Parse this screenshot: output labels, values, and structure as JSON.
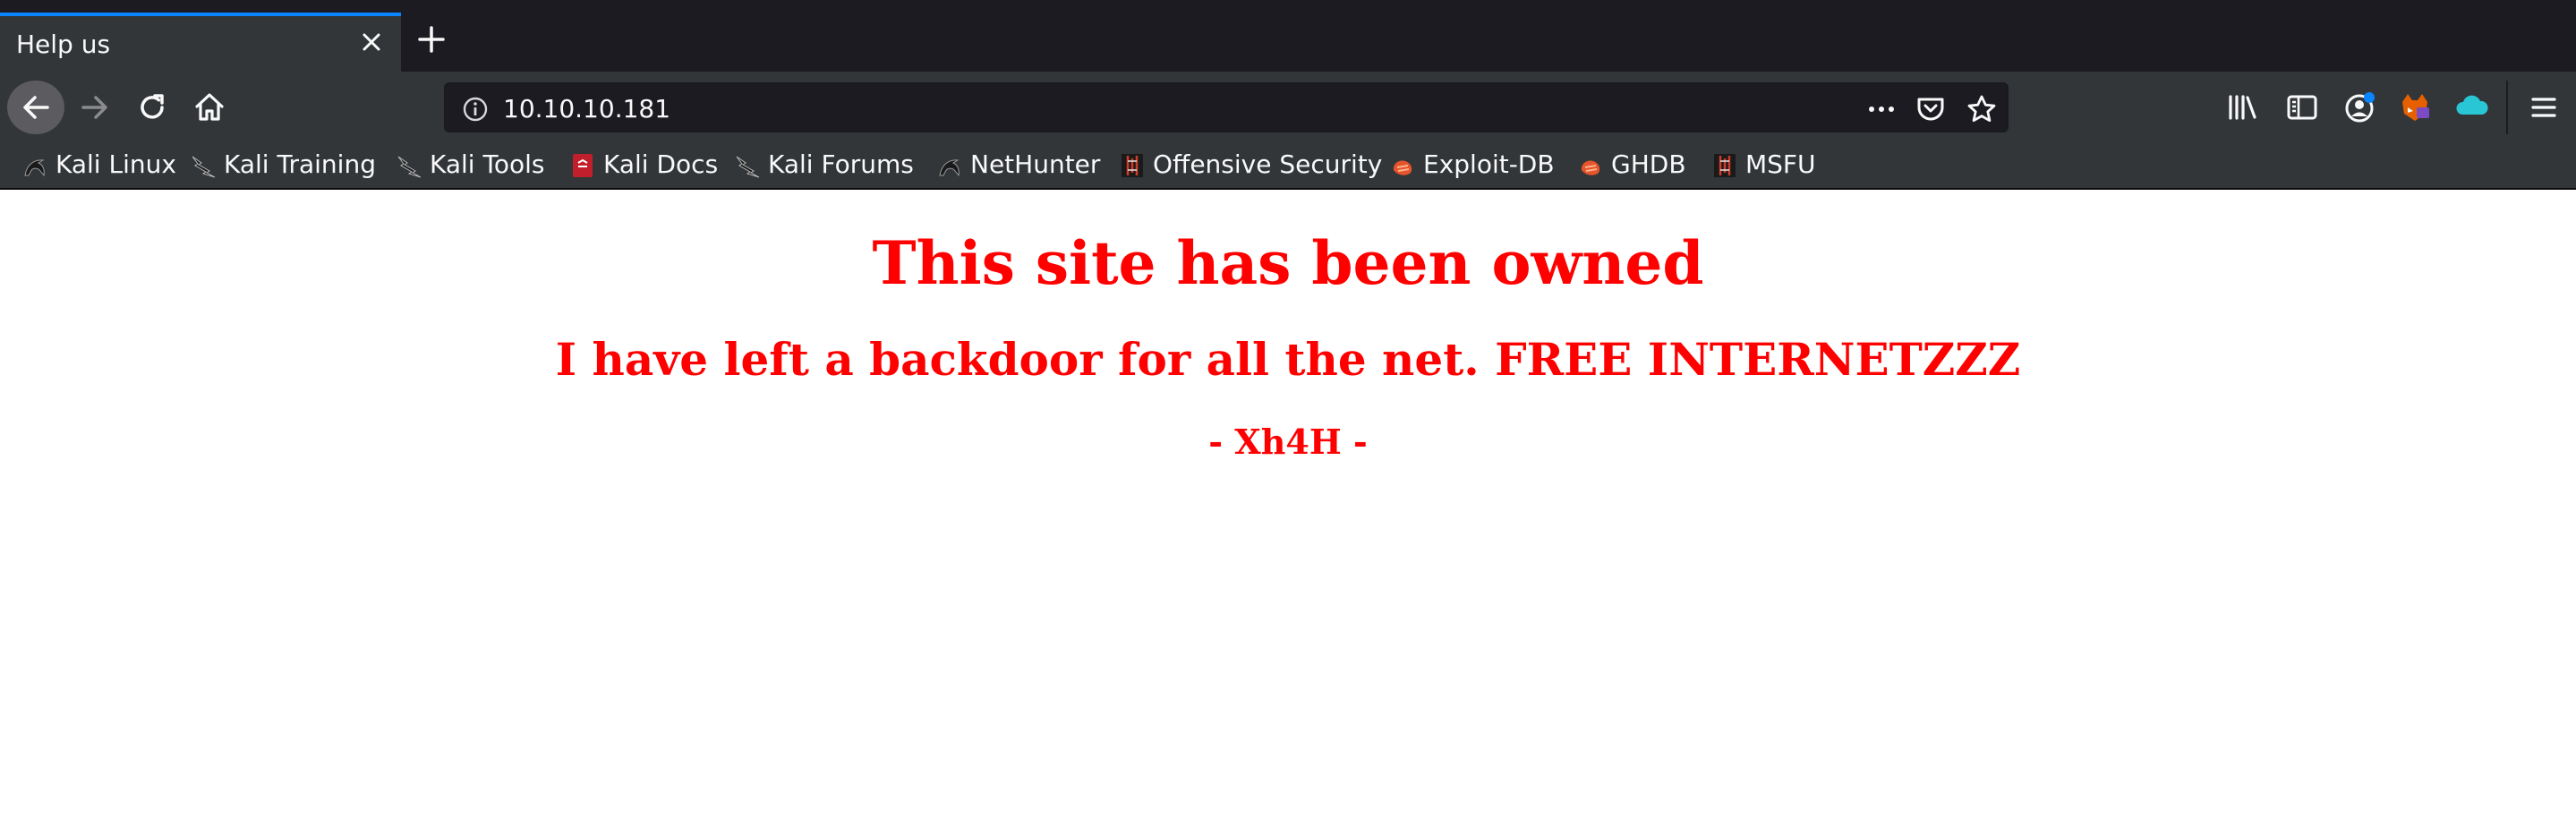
{
  "browser": {
    "tab": {
      "title": "Help us"
    },
    "url": "10.10.10.181",
    "bookmarks": [
      {
        "label": "Kali Linux",
        "icon": "kali-dragon-icon"
      },
      {
        "label": "Kali Training",
        "icon": "kali-dragon-icon"
      },
      {
        "label": "Kali Tools",
        "icon": "kali-dragon-icon"
      },
      {
        "label": "Kali Docs",
        "icon": "kali-docs-icon"
      },
      {
        "label": "Kali Forums",
        "icon": "kali-dragon-icon"
      },
      {
        "label": "NetHunter",
        "icon": "nethunter-icon"
      },
      {
        "label": "Offensive Security",
        "icon": "offsec-icon"
      },
      {
        "label": "Exploit-DB",
        "icon": "exploitdb-icon"
      },
      {
        "label": "GHDB",
        "icon": "exploitdb-icon"
      },
      {
        "label": "MSFU",
        "icon": "offsec-icon"
      }
    ],
    "colors": {
      "chrome_dark": "#1c1b22",
      "toolbar": "#323639",
      "accent": "#0a84ff",
      "page_text": "#ff0000"
    }
  },
  "page": {
    "heading": "This site has been owned",
    "subheading": "I have left a backdoor for all the net. FREE INTERNETZZZ",
    "signature": "- Xh4H -"
  }
}
